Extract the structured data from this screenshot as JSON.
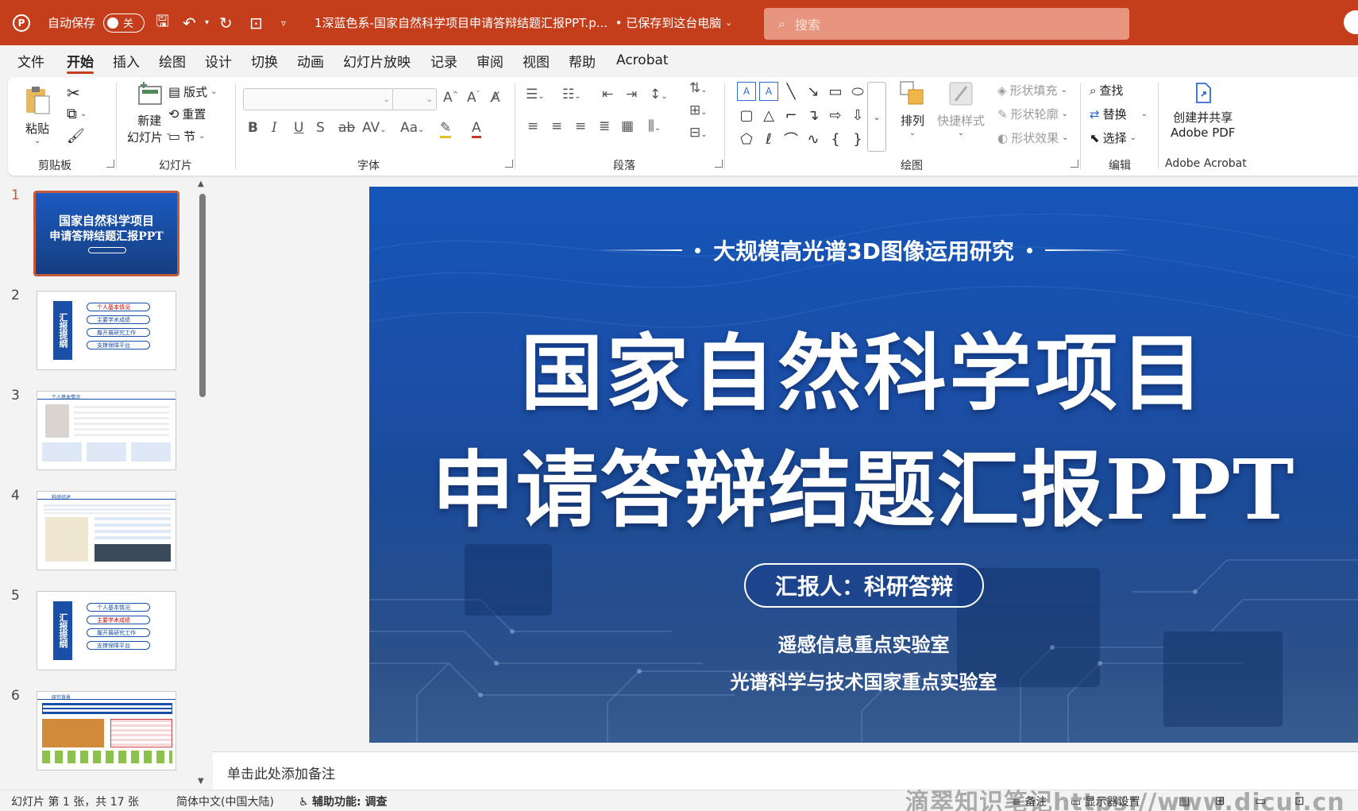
{
  "titlebar": {
    "autosave_label": "自动保存",
    "autosave_state": "关",
    "document_title": "1深蓝色系-国家自然科学项目申请答辩结题汇报PPT.p...",
    "save_status": "• 已保存到这台电脑",
    "search_placeholder": "搜索"
  },
  "menu": {
    "tabs": [
      "文件",
      "开始",
      "插入",
      "绘图",
      "设计",
      "切换",
      "动画",
      "幻灯片放映",
      "记录",
      "审阅",
      "视图",
      "帮助",
      "Acrobat"
    ],
    "active": "开始"
  },
  "ribbon": {
    "clipboard": {
      "paste": "粘贴",
      "label": "剪贴板"
    },
    "slides": {
      "new_slide_1": "新建",
      "new_slide_2": "幻灯片",
      "layout": "版式",
      "reset": "重置",
      "section": "节",
      "label": "幻灯片"
    },
    "font": {
      "label": "字体"
    },
    "paragraph": {
      "label": "段落"
    },
    "drawing": {
      "arrange": "排列",
      "quick_styles": "快捷样式",
      "shape_fill": "形状填充",
      "shape_outline": "形状轮廓",
      "shape_effects": "形状效果",
      "label": "绘图"
    },
    "editing": {
      "find": "查找",
      "replace": "替换",
      "select": "选择",
      "label": "编辑"
    },
    "acrobat": {
      "line1": "创建并共享",
      "line2": "Adobe PDF",
      "label": "Adobe Acrobat"
    }
  },
  "thumbnails": {
    "numbers": [
      "1",
      "2",
      "3",
      "4",
      "5",
      "6"
    ],
    "t1_title1": "国家自然科学项目",
    "t1_title2": "申请答辩结题汇报PPT",
    "toc_title": "汇报提纲",
    "toc_items": [
      "个人基本情况",
      "主要学术成绩",
      "履开展研究工作",
      "支撑保障平台"
    ],
    "t3_header": "个人基本情况",
    "t4_header": "科研综述",
    "t6_header": "研究背景"
  },
  "slide": {
    "subtitle": "大规模高光谱3D图像运用研究",
    "title_line1": "国家自然科学项目",
    "title_line2": "申请答辩结题汇报PPT",
    "reporter": "汇报人：科研答辩",
    "lab1": "遥感信息重点实验室",
    "lab2": "光谱科学与技术国家重点实验室"
  },
  "notes": {
    "placeholder": "单击此处添加备注"
  },
  "statusbar": {
    "slide_info": "幻灯片 第 1 张，共 17 张",
    "language": "简体中文(中国大陆)",
    "accessibility": "辅助功能: 调查",
    "notes_btn": "备注",
    "display_settings": "显示器设置",
    "watermark": "滴翠知识笔记https://www.dicui.cn"
  },
  "colors": {
    "accent": "#c43e1c",
    "slide_blue": "#1a4fa8"
  }
}
